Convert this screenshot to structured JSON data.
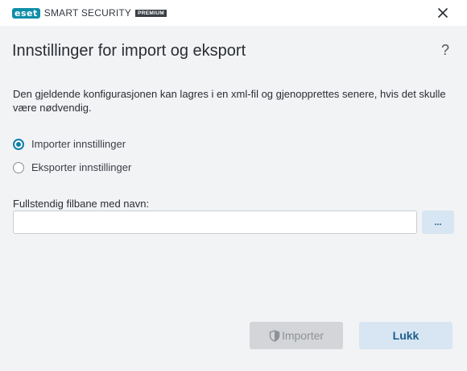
{
  "app": {
    "logo_text": "eset",
    "product_name": "SMART SECURITY",
    "edition": "PREMIUM"
  },
  "dialog": {
    "title": "Innstillinger for import og eksport",
    "help_label": "?",
    "description": "Den gjeldende konfigurasjonen kan lagres i en xml-fil og gjenopprettes senere, hvis det skulle være nødvendig.",
    "options": [
      {
        "label": "Importer innstillinger",
        "selected": true
      },
      {
        "label": "Eksporter innstillinger",
        "selected": false
      }
    ],
    "path_label": "Fullstendig filbane med navn:",
    "path_value": "",
    "browse_label": "...",
    "import_button": "Importer",
    "close_button": "Lukk"
  },
  "colors": {
    "accent": "#0f7ea8",
    "logo": "#0f8fa8",
    "button_primary_bg": "#d7e6f2",
    "button_disabled_bg": "#d3d5d8"
  }
}
